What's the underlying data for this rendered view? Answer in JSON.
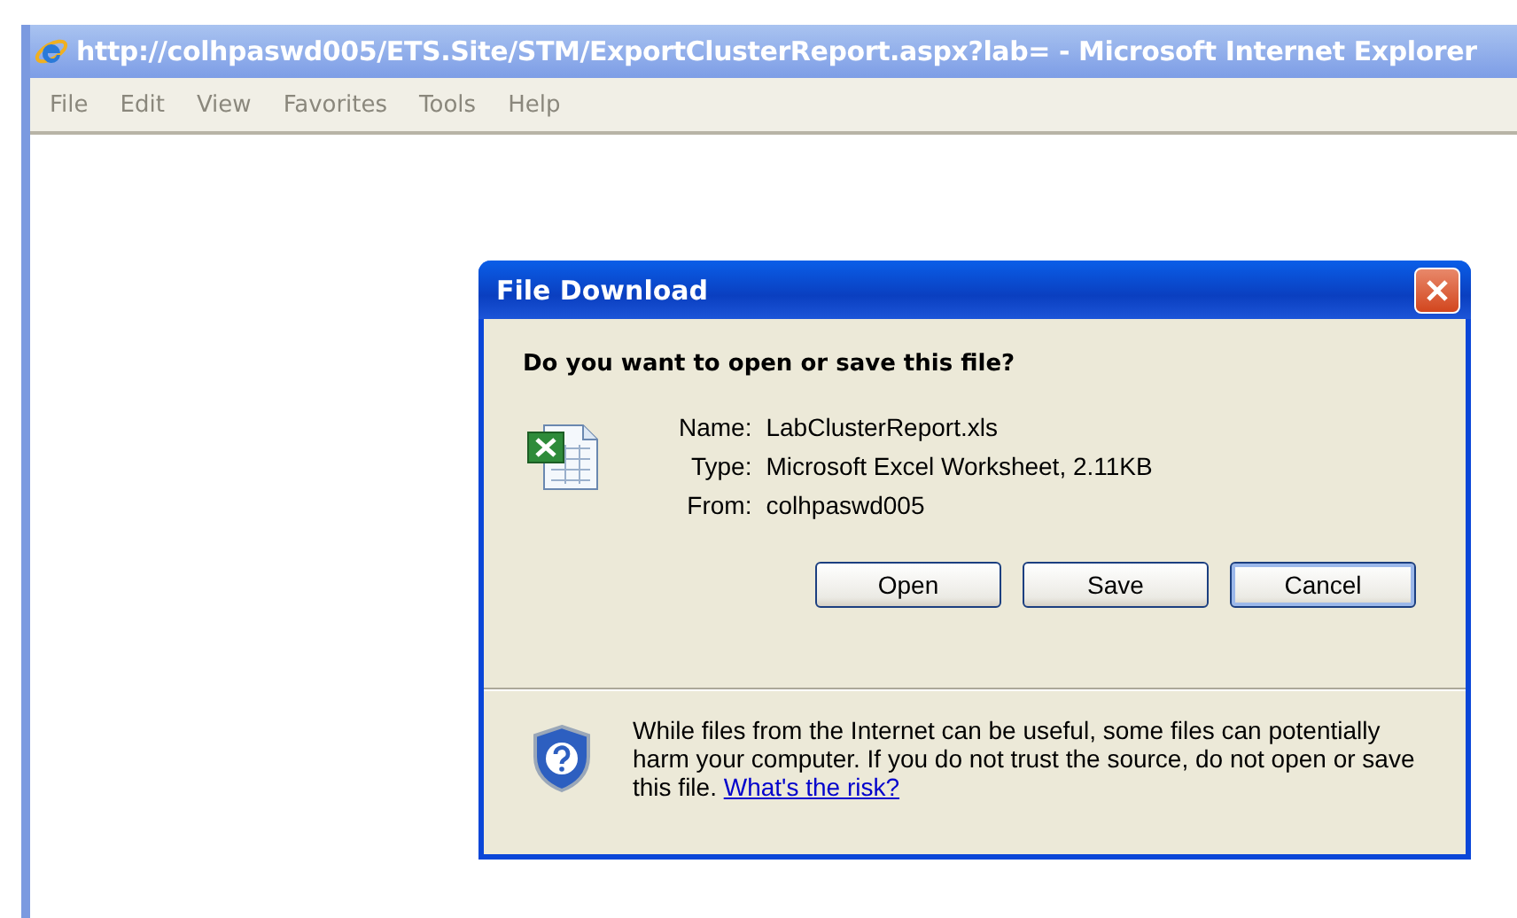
{
  "window": {
    "title": "http://colhpaswd005/ETS.Site/STM/ExportClusterReport.aspx?lab= - Microsoft Internet Explorer"
  },
  "menu": [
    {
      "label": "File"
    },
    {
      "label": "Edit"
    },
    {
      "label": "View"
    },
    {
      "label": "Favorites"
    },
    {
      "label": "Tools"
    },
    {
      "label": "Help"
    }
  ],
  "dialog": {
    "title": "File Download",
    "question": "Do you want to open or save this file?",
    "fields": [
      {
        "label": "Name:",
        "value": "LabClusterReport.xls"
      },
      {
        "label": "Type:",
        "value": "Microsoft Excel Worksheet, 2.11KB"
      },
      {
        "label": "From:",
        "value": "colhpaswd005"
      }
    ],
    "buttons": [
      {
        "label": "Open",
        "selected": false
      },
      {
        "label": "Save",
        "selected": false
      },
      {
        "label": "Cancel",
        "selected": true
      }
    ],
    "warning": "While files from the Internet can be useful, some files can potentially harm your computer. If you do not trust the source, do not open or save this file. ",
    "link": "What's the risk?"
  }
}
